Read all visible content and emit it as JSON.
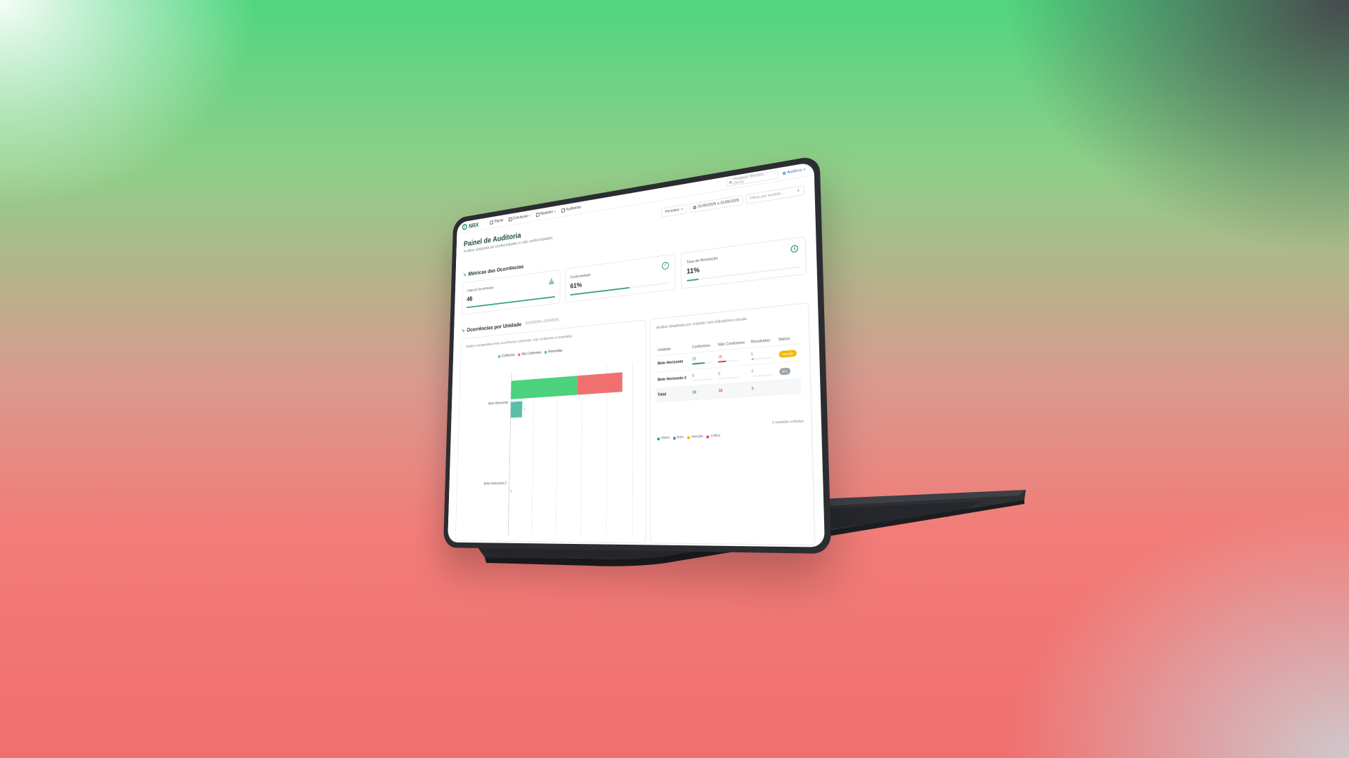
{
  "nav": {
    "logo_text": "NRX",
    "items": [
      {
        "label": "Painel",
        "icon": "dashboard-icon"
      },
      {
        "label": "Estruturas",
        "icon": "structure-icon",
        "dropdown": true
      },
      {
        "label": "Modelos",
        "icon": "template-icon",
        "dropdown": true
      },
      {
        "label": "Auditorias",
        "icon": "clipboard-icon"
      }
    ],
    "search_placeholder": "Pesquisar (Recurso... Ctrl+K)",
    "user_label": "Auditora"
  },
  "header": {
    "title": "Painel de Auditoria",
    "subtitle": "Análise completa de conformidades e não conformidades",
    "period_label": "Períodos",
    "date_range": "01/05/2025 a 31/05/2025",
    "model_filter_placeholder": "Filtrar por modelo..."
  },
  "metrics": {
    "section_title": "Métricas das Ocorrências",
    "cards": [
      {
        "label": "Total de Ocorrências",
        "value": "46",
        "progress": 1.0,
        "icon": "bar-chart-icon"
      },
      {
        "label": "Conformidade",
        "value": "61%",
        "progress": 0.61,
        "icon": "check-circle-icon"
      },
      {
        "label": "Taxa de Resolução",
        "value": "11%",
        "progress": 0.11,
        "icon": "clock-icon"
      }
    ]
  },
  "units": {
    "section_title": "Ocorrências por Unidade",
    "section_date": "(01/05/2025 a 31/05/2025)",
    "chart_description": "Análise comparativa entre ocorrências conformes, não conformes e resolvidas",
    "table_description": "Análise detalhada por unidade com indicadores visuais",
    "table_headers": [
      "Unidade",
      "Conformes",
      "Não Conformes",
      "Resolvidas",
      "Status"
    ],
    "rows": [
      {
        "unit": "Belo Horizonte",
        "conformes": "28",
        "nao_conformes": "18",
        "resolvidas": "5",
        "status": "Atenção",
        "status_color": "#f2b705"
      },
      {
        "unit": "Belo Horizonte 2",
        "conformes": "0",
        "nao_conformes": "0",
        "resolvidas": "0",
        "status": "N/A",
        "status_color": "#9aa1a9"
      }
    ],
    "total": {
      "label": "Total",
      "conformes": "28",
      "nao_conformes": "18",
      "resolvidas": "5"
    },
    "footer_note": "2 unidades exibidas",
    "status_legend": [
      {
        "label": "Ótimo",
        "color": "#2f9b72"
      },
      {
        "label": "Bom",
        "color": "#3a86c8"
      },
      {
        "label": "Atenção",
        "color": "#f2b705"
      },
      {
        "label": "Crítico",
        "color": "#e04848"
      }
    ]
  },
  "chart_data": {
    "type": "bar",
    "orientation": "horizontal",
    "stacked": true,
    "categories": [
      "Belo Horizonte",
      "Belo Horizonte 2"
    ],
    "series": [
      {
        "name": "Conformes",
        "values": [
          28,
          0
        ],
        "color": "#4cd17d"
      },
      {
        "name": "Não Conformes",
        "values": [
          18,
          0
        ],
        "color": "#f07070"
      },
      {
        "name": "Resolvidas",
        "values": [
          5,
          0
        ],
        "color": "#5bbfa8"
      }
    ],
    "data_labels": [
      "5",
      "0"
    ],
    "xlim": [
      0,
      50
    ],
    "grid": true,
    "legend_position": "top"
  },
  "colors": {
    "accent": "#2f9b72",
    "title": "#1f4d3f",
    "danger": "#e04848",
    "warning": "#f2b705"
  }
}
